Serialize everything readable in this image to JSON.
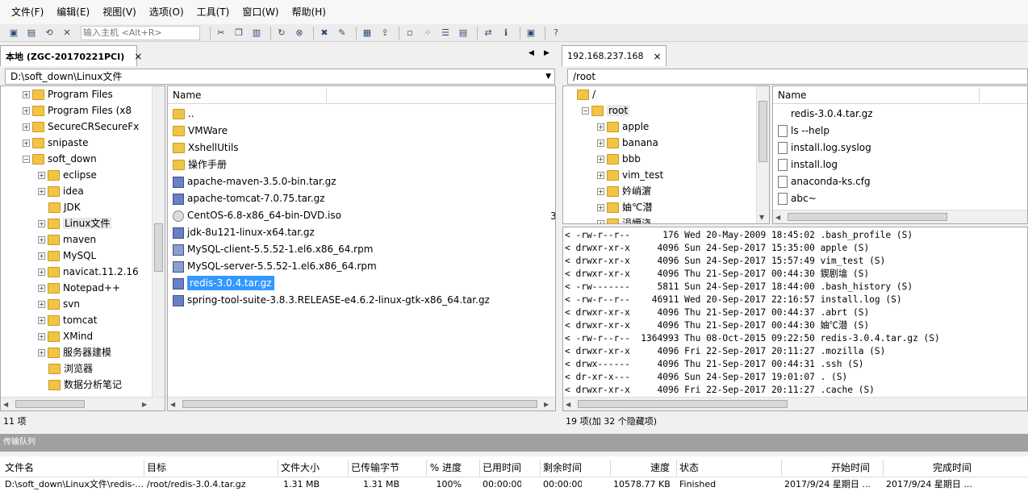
{
  "menu": [
    "文件(F)",
    "编辑(E)",
    "视图(V)",
    "选项(O)",
    "工具(T)",
    "窗口(W)",
    "帮助(H)"
  ],
  "toolbar": {
    "host_placeholder": "输入主机 <Alt+R>"
  },
  "local": {
    "tab_title": "本地 (ZGC-20170221PCI)",
    "tab_close": "×",
    "path": "D:\\soft_down\\Linux文件",
    "tree": [
      {
        "label": "Program Files",
        "indent": 1
      },
      {
        "label": "Program Files (x8",
        "indent": 1
      },
      {
        "label": "SecureCRSecureFx",
        "indent": 1
      },
      {
        "label": "snipaste",
        "indent": 1
      },
      {
        "label": "soft_down",
        "indent": 1,
        "open": true
      },
      {
        "label": "eclipse",
        "indent": 2
      },
      {
        "label": "idea",
        "indent": 2
      },
      {
        "label": "JDK",
        "indent": 2,
        "noexp": true
      },
      {
        "label": "Linux文件",
        "indent": 2,
        "current": true
      },
      {
        "label": "maven",
        "indent": 2
      },
      {
        "label": "MySQL",
        "indent": 2
      },
      {
        "label": "navicat.11.2.16",
        "indent": 2
      },
      {
        "label": "Notepad++",
        "indent": 2
      },
      {
        "label": "svn",
        "indent": 2
      },
      {
        "label": "tomcat",
        "indent": 2
      },
      {
        "label": "XMind",
        "indent": 2
      },
      {
        "label": "服务器建模",
        "indent": 2
      },
      {
        "label": "浏览器",
        "indent": 2,
        "noexp": true
      },
      {
        "label": "数据分析笔记",
        "indent": 2,
        "noexp": true
      }
    ],
    "list_header": "Name",
    "files": [
      {
        "name": "..",
        "icon": "folder"
      },
      {
        "name": "VMWare",
        "icon": "folder"
      },
      {
        "name": "XshellUtils",
        "icon": "folder"
      },
      {
        "name": "操作手册",
        "icon": "folder"
      },
      {
        "name": "apache-maven-3.5.0-bin.tar.gz",
        "icon": "archive"
      },
      {
        "name": "apache-tomcat-7.0.75.tar.gz",
        "icon": "archive"
      },
      {
        "name": "CentOS-6.8-x86_64-bin-DVD.iso",
        "icon": "disc"
      },
      {
        "name": "jdk-8u121-linux-x64.tar.gz",
        "icon": "archive"
      },
      {
        "name": "MySQL-client-5.5.52-1.el6.x86_64.rpm",
        "icon": "rpm"
      },
      {
        "name": "MySQL-server-5.5.52-1.el6.x86_64.rpm",
        "icon": "rpm"
      },
      {
        "name": "redis-3.0.4.tar.gz",
        "icon": "archive",
        "selected": true
      },
      {
        "name": "spring-tool-suite-3.8.3.RELEASE-e4.6.2-linux-gtk-x86_64.tar.gz",
        "icon": "archive"
      }
    ],
    "clipped_char": "3",
    "status": "11 项"
  },
  "remote": {
    "tab_title": "192.168.237.168",
    "tab_close": "×",
    "path": "/root",
    "tree": [
      {
        "label": "/",
        "indent": 0,
        "noexp": true
      },
      {
        "label": "root",
        "indent": 1,
        "open": true,
        "current": true
      },
      {
        "label": "apple",
        "indent": 2
      },
      {
        "label": "banana",
        "indent": 2
      },
      {
        "label": "bbb",
        "indent": 2
      },
      {
        "label": "vim_test",
        "indent": 2
      },
      {
        "label": "妗峭濵",
        "indent": 2
      },
      {
        "label": "妯℃潜",
        "indent": 2
      },
      {
        "label": "涓嬭浇",
        "indent": 2
      }
    ],
    "list_header": "Name",
    "files": [
      {
        "name": "redis-3.0.4.tar.gz",
        "icon": "none"
      },
      {
        "name": "ls --help",
        "icon": "file"
      },
      {
        "name": "install.log.syslog",
        "icon": "file"
      },
      {
        "name": "install.log",
        "icon": "file"
      },
      {
        "name": "anaconda-ks.cfg",
        "icon": "file"
      },
      {
        "name": "abc~",
        "icon": "file"
      }
    ],
    "log": [
      "< -rw-r--r--      176 Wed 20-May-2009 18:45:02 .bash_profile (S)",
      "< drwxr-xr-x     4096 Sun 24-Sep-2017 15:35:00 apple (S)",
      "< drwxr-xr-x     4096 Sun 24-Sep-2017 15:57:49 vim_test (S)",
      "< drwxr-xr-x     4096 Thu 21-Sep-2017 00:44:30 鍥剧墖 (S)",
      "< -rw-------     5811 Sun 24-Sep-2017 18:44:00 .bash_history (S)",
      "< -rw-r--r--    46911 Wed 20-Sep-2017 22:16:57 install.log (S)",
      "< drwxr-xr-x     4096 Thu 21-Sep-2017 00:44:37 .abrt (S)",
      "< drwxr-xr-x     4096 Thu 21-Sep-2017 00:44:30 妯℃潜 (S)",
      "< -rw-r--r--  1364993 Thu 08-Oct-2015 09:22:50 redis-3.0.4.tar.gz (S)",
      "< drwxr-xr-x     4096 Fri 22-Sep-2017 20:11:27 .mozilla (S)",
      "< drwx------     4096 Thu 21-Sep-2017 00:44:31 .ssh (S)",
      "< dr-xr-x---     4096 Sun 24-Sep-2017 19:01:07 . (S)",
      "< drwxr-xr-x     4096 Fri 22-Sep-2017 20:11:27 .cache (S)"
    ],
    "status": "19 项(加 32 个隐藏项)"
  },
  "queue": {
    "title": "传输队列",
    "columns": [
      "文件名",
      "目标",
      "文件大小",
      "已传输字节",
      "% 进度",
      "已用时间",
      "剩余时间",
      "速度",
      "状态",
      "开始时间",
      "完成时间"
    ],
    "rows": [
      [
        "D:\\soft_down\\Linux文件\\redis-...",
        "/root/redis-3.0.4.tar.gz",
        "1.31 MB",
        "1.31 MB",
        "100%",
        "00:00:00",
        "00:00:00",
        "10578.77 KB/s",
        "Finished",
        "2017/9/24 星期日 ...",
        "2017/9/24 星期日 ..."
      ]
    ]
  }
}
